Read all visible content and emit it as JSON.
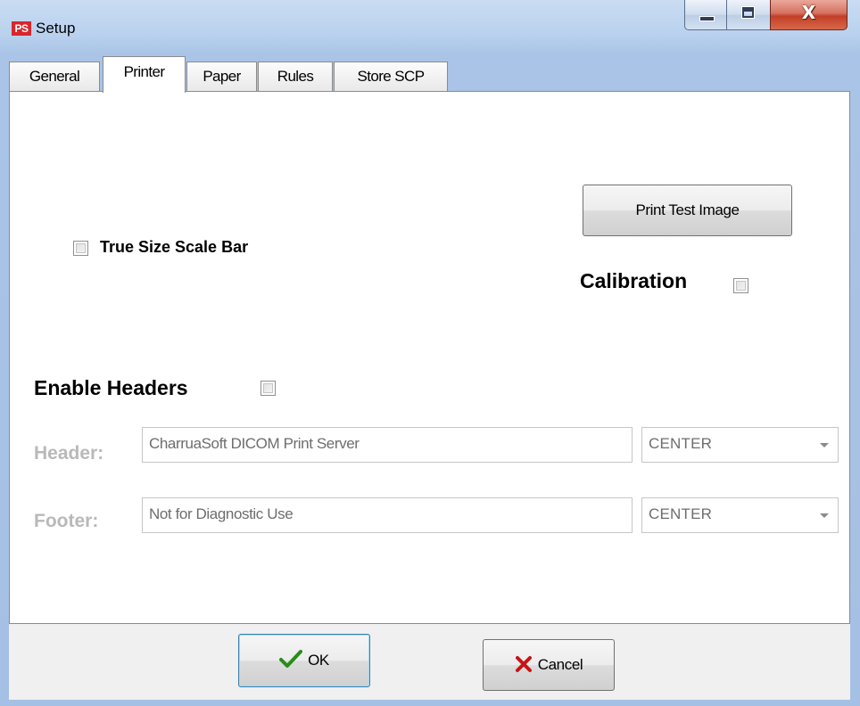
{
  "window": {
    "title": "Setup",
    "icon_text": "PS",
    "controls": {
      "minimize": "minimize",
      "maximize": "maximize",
      "close": "X"
    }
  },
  "tabs": [
    {
      "label": "General",
      "active": false
    },
    {
      "label": "Printer",
      "active": true
    },
    {
      "label": "Paper",
      "active": false
    },
    {
      "label": "Rules",
      "active": false
    },
    {
      "label": "Store SCP",
      "active": false
    }
  ],
  "printer": {
    "print_test_button": "Print Test Image",
    "true_size_scale_bar": {
      "label": "True Size Scale Bar",
      "checked": false
    },
    "calibration": {
      "label": "Calibration",
      "checked": false
    },
    "enable_headers": {
      "label": "Enable Headers",
      "checked": false
    },
    "header": {
      "label": "Header:",
      "value": "CharruaSoft DICOM Print Server",
      "alignment": "CENTER"
    },
    "footer": {
      "label": "Footer:",
      "value": "Not for Diagnostic Use",
      "alignment": "CENTER"
    }
  },
  "buttons": {
    "ok": "OK",
    "cancel": "Cancel"
  },
  "colors": {
    "title_bar": "#b9d1ee",
    "close_button": "#c23f26",
    "ok_icon": "#2a8c1a",
    "cancel_icon": "#c81414",
    "disabled_text": "#b9b9b9"
  },
  "icons": {
    "ok": "check-icon",
    "cancel": "x-mark-icon"
  }
}
